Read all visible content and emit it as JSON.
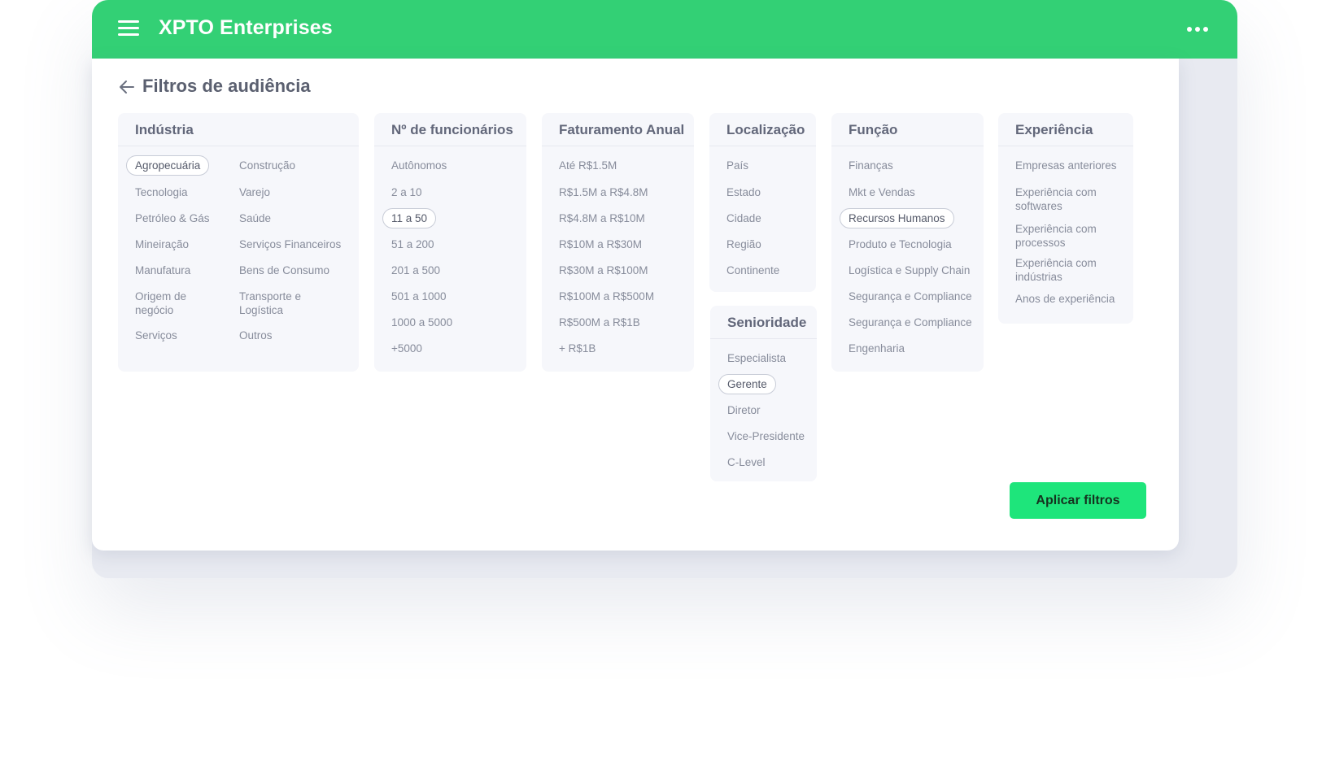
{
  "app": {
    "title": "XPTO Enterprises"
  },
  "page": {
    "title": "Filtros de audiência"
  },
  "industria": {
    "title": "Indústria",
    "left": [
      "Agropecuária",
      "Tecnologia",
      "Petróleo & Gás",
      "Mineiração",
      "Manufatura",
      "Origem de negócio",
      "Serviços"
    ],
    "right": [
      "Construção",
      "Varejo",
      "Saúde",
      "Serviços Financeiros",
      "Bens de Consumo",
      "Transporte e Logística",
      "Outros"
    ],
    "selected": "Agropecuária"
  },
  "funcionarios": {
    "title": "Nº de funcionários",
    "items": [
      "Autônomos",
      "2 a 10",
      "11 a 50",
      "51 a 200",
      "201 a 500",
      "501 a 1000",
      "1000 a 5000",
      "+5000"
    ],
    "selected": "11 a 50"
  },
  "faturamento": {
    "title": "Faturamento Anual",
    "items": [
      "Até R$1.5M",
      "R$1.5M a R$4.8M",
      "R$4.8M a R$10M",
      "R$10M a R$30M",
      "R$30M a R$100M",
      "R$100M a R$500M",
      "R$500M a R$1B",
      "+ R$1B"
    ]
  },
  "localizacao": {
    "title": "Localização",
    "items": [
      "País",
      "Estado",
      "Cidade",
      "Região",
      "Continente"
    ]
  },
  "senioridade": {
    "title": "Senioridade",
    "items": [
      "Especialista",
      "Gerente",
      "Diretor",
      "Vice-Presidente",
      "C-Level"
    ],
    "selected": "Gerente"
  },
  "funcao": {
    "title": "Função",
    "items": [
      "Finanças",
      "Mkt e Vendas",
      "Recursos Humanos",
      "Produto e Tecnologia",
      "Logística e Supply Chain",
      "Segurança e Compliance",
      "Segurança e Compliance",
      "Engenharia"
    ],
    "selected": "Recursos Humanos"
  },
  "experiencia": {
    "title": "Experiência",
    "items": [
      "Empresas anteriores",
      "Experiência com softwares",
      "Experiência com processos",
      "Experiência com indústrias",
      "Anos de experiência"
    ]
  },
  "actions": {
    "apply_label": "Aplicar filtros"
  },
  "icons": {
    "menu": "hamburger-menu-icon",
    "more": "more-horizontal-icon",
    "back": "arrow-left-icon"
  },
  "colors": {
    "brand": "#33d075",
    "apply_button": "#1ee57b"
  }
}
